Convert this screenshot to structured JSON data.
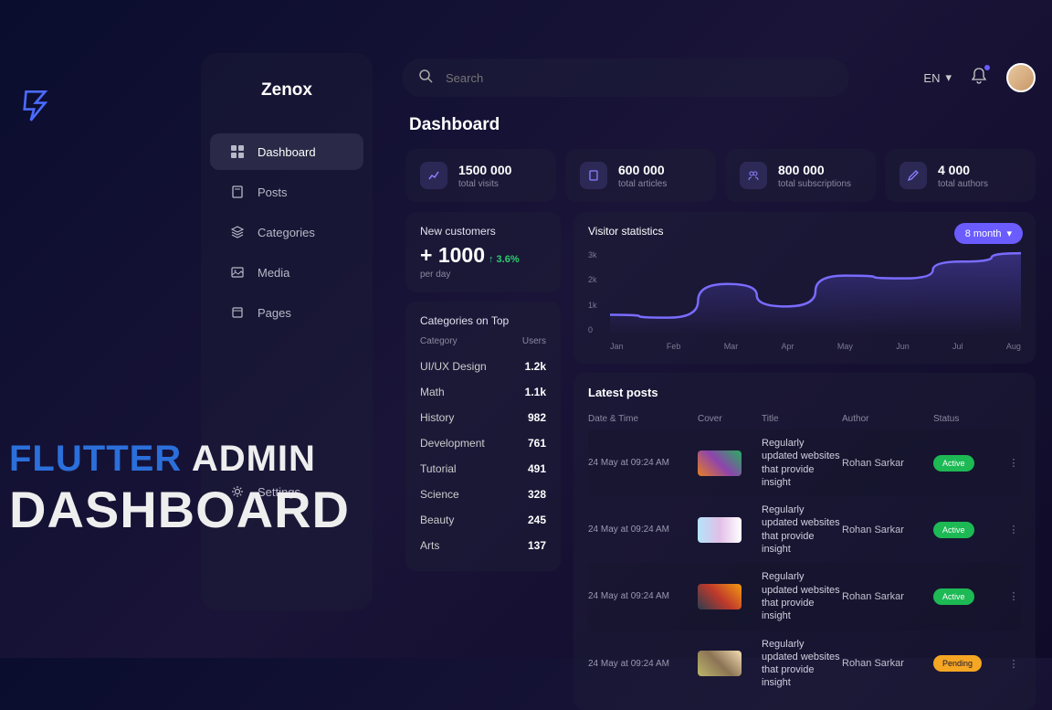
{
  "brand": "Zenox",
  "sidebar": {
    "items": [
      {
        "label": "Dashboard"
      },
      {
        "label": "Posts"
      },
      {
        "label": "Categories"
      },
      {
        "label": "Media"
      },
      {
        "label": "Pages"
      }
    ],
    "settings_label": "Settings"
  },
  "search": {
    "placeholder": "Search"
  },
  "lang": "EN",
  "page_title": "Dashboard",
  "stats": [
    {
      "value": "1500 000",
      "label": "total visits"
    },
    {
      "value": "600 000",
      "label": "total articles"
    },
    {
      "value": "800 000",
      "label": "total subscriptions"
    },
    {
      "value": "4 000",
      "label": "total authors"
    }
  ],
  "new_customers": {
    "title": "New customers",
    "value": "+ 1000",
    "delta": "↑ 3.6%",
    "sub": "per day"
  },
  "categories": {
    "title": "Categories on Top",
    "col_cat": "Category",
    "col_users": "Users",
    "rows": [
      {
        "name": "UI/UX Design",
        "users": "1.2k"
      },
      {
        "name": "Math",
        "users": "1.1k"
      },
      {
        "name": "History",
        "users": "982"
      },
      {
        "name": "Development",
        "users": "761"
      },
      {
        "name": "Tutorial",
        "users": "491"
      },
      {
        "name": "Science",
        "users": "328"
      },
      {
        "name": "Beauty",
        "users": "245"
      },
      {
        "name": "Arts",
        "users": "137"
      }
    ]
  },
  "visitor_stats": {
    "title": "Visitor statistics",
    "range": "8 month"
  },
  "chart_data": {
    "type": "line",
    "title": "Visitor statistics",
    "xlabel": "",
    "ylabel": "",
    "ylim": [
      0,
      3000
    ],
    "y_ticks": [
      "3k",
      "2k",
      "1k",
      "0"
    ],
    "categories": [
      "Jan",
      "Feb",
      "Mar",
      "Apr",
      "May",
      "Jun",
      "Jul",
      "Aug"
    ],
    "values": [
      700,
      600,
      1800,
      1000,
      2100,
      2000,
      2600,
      2900
    ]
  },
  "latest_posts": {
    "title": "Latest posts",
    "headers": {
      "date": "Date & Time",
      "cover": "Cover",
      "title": "Title",
      "author": "Author",
      "status": "Status"
    },
    "rows": [
      {
        "date": "24 May at 09:24 AM",
        "title": "Regularly updated websites that provide insight",
        "author": "Rohan Sarkar",
        "status": "Active",
        "cover_gradient": "linear-gradient(45deg,#e67e22,#8e44ad,#27ae60)"
      },
      {
        "date": "24 May at 09:24 AM",
        "title": "Regularly updated websites that provide insight",
        "author": "Rohan Sarkar",
        "status": "Active",
        "cover_gradient": "linear-gradient(90deg,#b3e5fc,#e1bee7,#fff)"
      },
      {
        "date": "24 May at 09:24 AM",
        "title": "Regularly updated websites that provide insight",
        "author": "Rohan Sarkar",
        "status": "Active",
        "cover_gradient": "linear-gradient(45deg,#2c3e50,#c0392b,#f39c12)"
      },
      {
        "date": "24 May at 09:24 AM",
        "title": "Regularly updated websites that provide insight",
        "author": "Rohan Sarkar",
        "status": "Pending",
        "cover_gradient": "linear-gradient(45deg,#bdb76b,#8b7355,#f5deb3)"
      }
    ]
  },
  "overlay": {
    "line1a": "FLUTTER",
    "line1b": "ADMIN",
    "line2": "DASHBOARD"
  }
}
